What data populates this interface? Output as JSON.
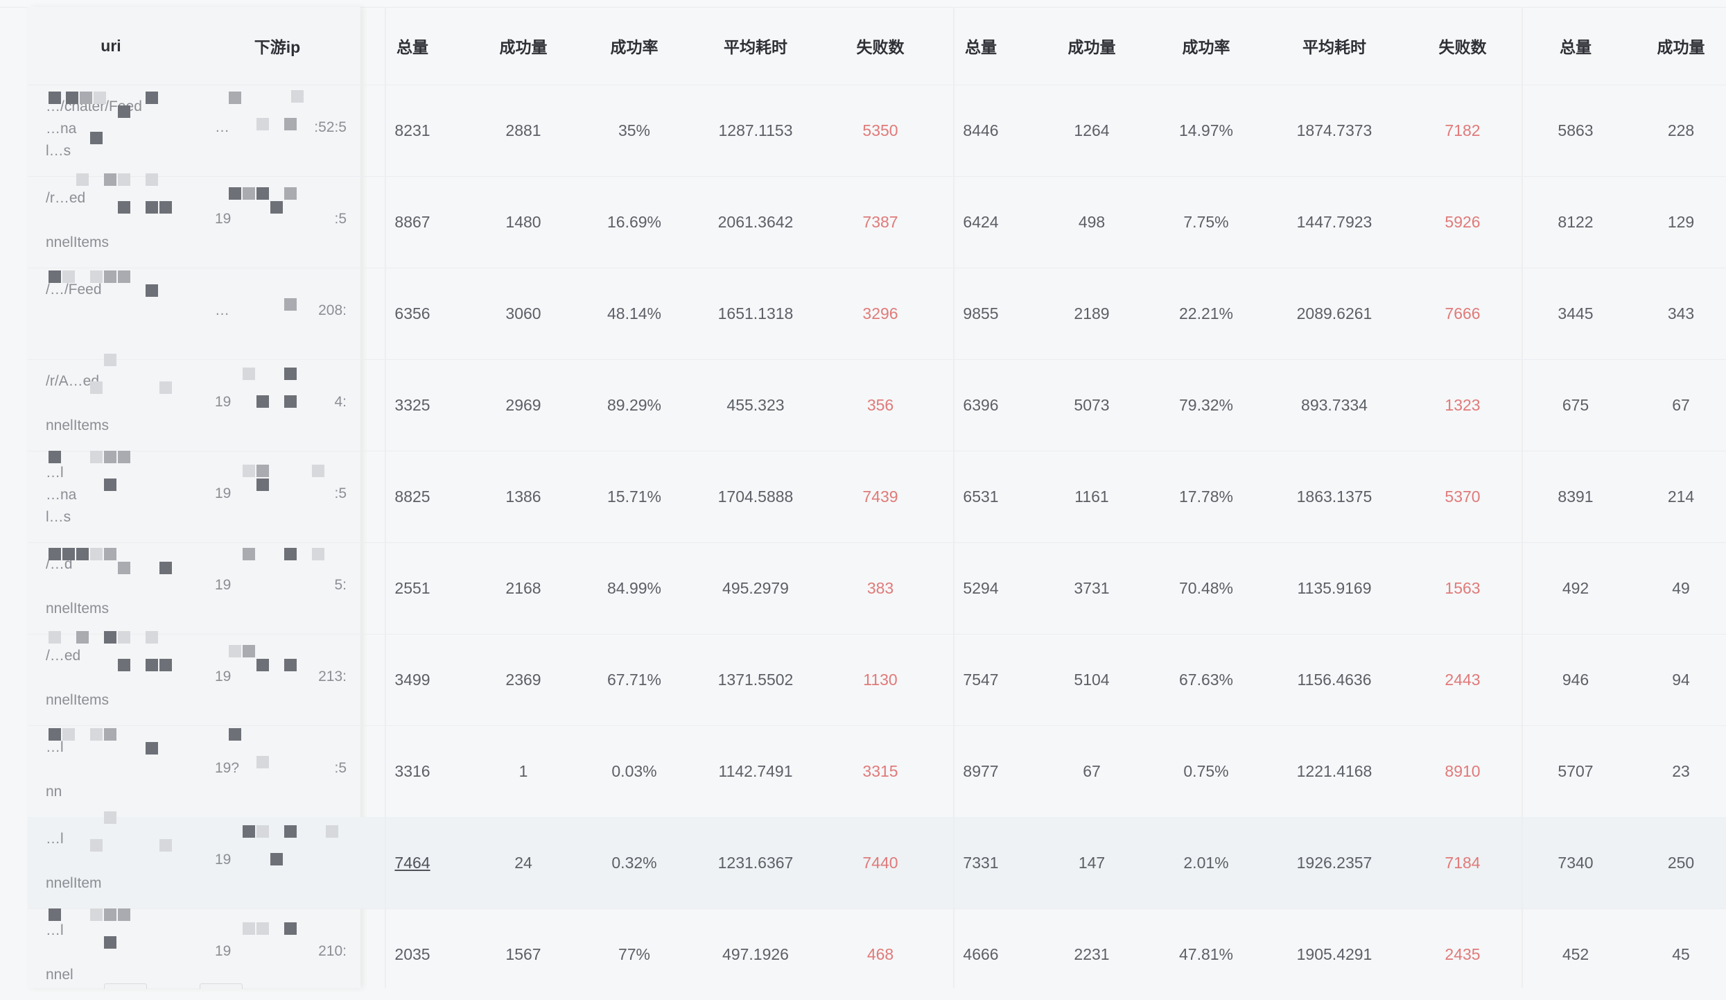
{
  "header": {
    "fixed": [
      "uri",
      "下游ip"
    ],
    "metrics": [
      "总量",
      "成功量",
      "成功率",
      "平均耗时",
      "失败数"
    ]
  },
  "rows": [
    {
      "uri_fragments": [
        "…/chater/Feed",
        "…na",
        "l…s"
      ],
      "ip_fragments": [
        "…",
        ":52:5"
      ],
      "g1": [
        "8231",
        "2881",
        "35%",
        "1287.1153",
        "5350"
      ],
      "g2": [
        "8446",
        "1264",
        "14.97%",
        "1874.7373",
        "7182"
      ],
      "g3": [
        "5863",
        "228"
      ]
    },
    {
      "uri_fragments": [
        "/r…ed",
        "",
        "nnelItems"
      ],
      "ip_fragments": [
        "19",
        ":5"
      ],
      "g1": [
        "8867",
        "1480",
        "16.69%",
        "2061.3642",
        "7387"
      ],
      "g2": [
        "6424",
        "498",
        "7.75%",
        "1447.7923",
        "5926"
      ],
      "g3": [
        "8122",
        "129"
      ]
    },
    {
      "uri_fragments": [
        "/…/Feed",
        "",
        ""
      ],
      "ip_fragments": [
        "…",
        "208:"
      ],
      "g1": [
        "6356",
        "3060",
        "48.14%",
        "1651.1318",
        "3296"
      ],
      "g2": [
        "9855",
        "2189",
        "22.21%",
        "2089.6261",
        "7666"
      ],
      "g3": [
        "3445",
        "343"
      ]
    },
    {
      "uri_fragments": [
        "/r/A…ed",
        "",
        "nnelItems"
      ],
      "ip_fragments": [
        "19",
        "4:"
      ],
      "g1": [
        "3325",
        "2969",
        "89.29%",
        "455.323",
        "356"
      ],
      "g2": [
        "6396",
        "5073",
        "79.32%",
        "893.7334",
        "1323"
      ],
      "g3": [
        "675",
        "67"
      ]
    },
    {
      "uri_fragments": [
        "…l",
        "…na",
        "l…s"
      ],
      "ip_fragments": [
        "19",
        ":5"
      ],
      "g1": [
        "8825",
        "1386",
        "15.71%",
        "1704.5888",
        "7439"
      ],
      "g2": [
        "6531",
        "1161",
        "17.78%",
        "1863.1375",
        "5370"
      ],
      "g3": [
        "8391",
        "214"
      ]
    },
    {
      "uri_fragments": [
        "/…d",
        "",
        "nnelItems"
      ],
      "ip_fragments": [
        "19",
        "5:"
      ],
      "g1": [
        "2551",
        "2168",
        "84.99%",
        "495.2979",
        "383"
      ],
      "g2": [
        "5294",
        "3731",
        "70.48%",
        "1135.9169",
        "1563"
      ],
      "g3": [
        "492",
        "49"
      ]
    },
    {
      "uri_fragments": [
        "/…ed",
        "",
        "nnelItems"
      ],
      "ip_fragments": [
        "19",
        "213:"
      ],
      "g1": [
        "3499",
        "2369",
        "67.71%",
        "1371.5502",
        "1130"
      ],
      "g2": [
        "7547",
        "5104",
        "67.63%",
        "1156.4636",
        "2443"
      ],
      "g3": [
        "946",
        "94"
      ]
    },
    {
      "uri_fragments": [
        "…l",
        "",
        "nn"
      ],
      "ip_fragments": [
        "19?",
        ":5"
      ],
      "g1": [
        "3316",
        "1",
        "0.03%",
        "1142.7491",
        "3315"
      ],
      "g2": [
        "8977",
        "67",
        "0.75%",
        "1221.4168",
        "8910"
      ],
      "g3": [
        "5707",
        "23"
      ]
    },
    {
      "uri_fragments": [
        "…l",
        "",
        "nnelItem"
      ],
      "ip_fragments": [
        "19",
        ""
      ],
      "g1": [
        "7464",
        "24",
        "0.32%",
        "1231.6367",
        "7440"
      ],
      "g2": [
        "7331",
        "147",
        "2.01%",
        "1926.2357",
        "7184"
      ],
      "g3": [
        "7340",
        "250"
      ]
    },
    {
      "uri_fragments": [
        "…l",
        "",
        "nnel"
      ],
      "ip_fragments": [
        "19",
        "210:"
      ],
      "g1": [
        "2035",
        "1567",
        "77%",
        "497.1926",
        "468"
      ],
      "g2": [
        "4666",
        "2231",
        "47.81%",
        "1905.4291",
        "2435"
      ],
      "g3": [
        "452",
        "45"
      ]
    }
  ],
  "colors": {
    "fail": "#e07a7a",
    "text": "#5c5f66",
    "header": "#2e3036"
  }
}
